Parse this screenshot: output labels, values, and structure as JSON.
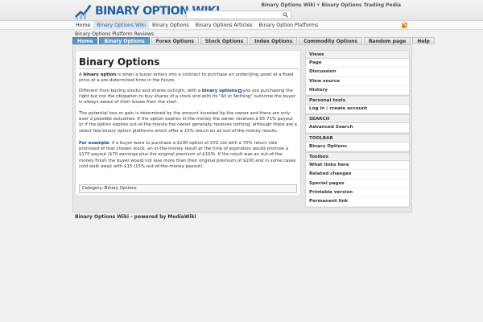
{
  "header": {
    "logo_text": "BINARY OPTION WIKI",
    "top_links": [
      "Binary Options Wiki",
      "Binary Options Trading Pedia"
    ],
    "top_links_sep": "•",
    "search_placeholder": "",
    "accent": "#1f5ea8"
  },
  "topnav": {
    "items": [
      "Home",
      "Binary Options Wiki",
      "Binary Options",
      "Binary Options Articles",
      "Binary Option Platforms"
    ],
    "active_index": 1
  },
  "breadcrumb": "Binary Options Platform Reviews",
  "tabs": {
    "items": [
      "Home",
      "Binary Options",
      "Forex Options",
      "Stock Options",
      "Index Options",
      "Commodity Options",
      "Random page",
      "Help"
    ],
    "active_index": 1
  },
  "article": {
    "title": "Binary Options",
    "p1_pre": "A ",
    "p1_bold": "binary option",
    "p1_post": " is when a buyer enters into a contract to purchase an underlying asset at a fixed price at a pre-determined time in the future.",
    "p2_pre": "Different from buying stocks and shares outright, with a ",
    "p2_link": "binary options",
    "p2_post": " you are purchasing the right but not the obligation to buy shares of a stock and with its \"All or Nothing\" outcome the buyer is always aware of their losses from the start.",
    "p3": "The potential loss or gain is determined by the amount invested by the owner and there are only ever 2 possible outcomes. If the option expires in-the-money the owner receives a 65-71% payout or if the option expires out-of-the-money the owner generally receives nothing, although there are a select few binary option platforms which offer a 15% return on all out-of-the-money results.",
    "p4_bold": "For example",
    "p4_post": ", if a buyer were to purchase a $100 option of XYZ Ltd with a 70% return rate promised of that chosen stock, an in-the-money result at the time of expiration would promise a $170 payout ($70 earnings plus the original premium of $100). If the result was an out-of-the-money finish the buyer would not lose more than their original premium of $100 and in some cases cold walk away with $15 (15% out-of-the-money payout).",
    "category": "Category: Binary Options"
  },
  "sidebar": {
    "views": {
      "title": "Views",
      "items": [
        "Page",
        "Discussion",
        "View source",
        "History"
      ]
    },
    "personal": {
      "title": "Personal tools",
      "items": [
        "Log in / create account"
      ]
    },
    "search": {
      "title": "SEARCH",
      "items": [
        "Advanced Search"
      ]
    },
    "toolbar": {
      "title": "TOOLBAR",
      "items": [
        "Binary Options"
      ]
    },
    "toolbox": {
      "title": "Toolbox",
      "items": [
        "What links here",
        "Related changes",
        "Special pages",
        "Printable version",
        "Permanent link"
      ]
    }
  },
  "footer": "Binary Options Wiki - powered by MediaWiki"
}
